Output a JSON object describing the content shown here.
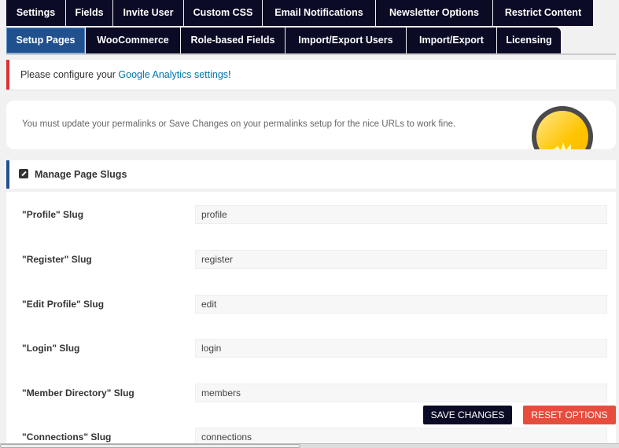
{
  "tabs_row1": [
    "Settings",
    "Fields",
    "Invite User",
    "Custom CSS",
    "Email Notifications",
    "Newsletter Options",
    "Restrict Content"
  ],
  "tabs_row2": [
    "Setup Pages",
    "WooCommerce",
    "Role-based Fields",
    "Import/Export Users",
    "Import/Export",
    "Licensing"
  ],
  "active_tab": "Setup Pages",
  "notice": {
    "prefix": "Please configure your ",
    "link": "Google Analytics settings",
    "suffix": "!"
  },
  "permalink_notice": "You must update your permalinks or Save Changes on your permalinks setup for the nice URLs to work fine.",
  "section": {
    "title": "Manage Page Slugs",
    "icon": "pencil-icon"
  },
  "slugs": [
    {
      "label": "\"Profile\" Slug",
      "value": "profile"
    },
    {
      "label": "\"Register\" Slug",
      "value": "register"
    },
    {
      "label": "\"Edit Profile\" Slug",
      "value": "edit"
    },
    {
      "label": "\"Login\" Slug",
      "value": "login"
    },
    {
      "label": "\"Member Directory\" Slug",
      "value": "members"
    },
    {
      "label": "\"Connections\" Slug",
      "value": "connections"
    }
  ],
  "buttons": {
    "save": "SAVE CHANGES",
    "reset": "RESET OPTIONS"
  },
  "colors": {
    "tab_bg": "#0b0b26",
    "active_tab": "#21508f",
    "error": "#dc3232",
    "reset": "#e74c3c",
    "link": "#0073aa"
  }
}
